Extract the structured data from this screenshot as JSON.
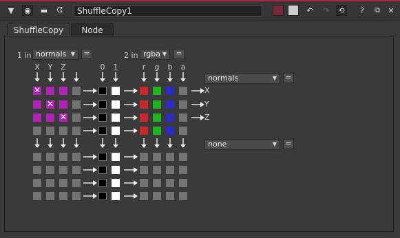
{
  "window": {
    "node_name": "ShuffleCopy1"
  },
  "tabs": [
    {
      "label": "ShuffleCopy"
    },
    {
      "label": "Node"
    }
  ],
  "input1": {
    "prefix": "1 in",
    "layer": "normals",
    "channels": [
      "X",
      "Y",
      "Z"
    ]
  },
  "input2": {
    "prefix": "2 in",
    "layer": "rgba",
    "channels": [
      "r",
      "g",
      "b",
      "a"
    ]
  },
  "const_channels": [
    "0",
    "1"
  ],
  "output1": {
    "layer": "normals",
    "channels": [
      "X",
      "Y",
      "Z"
    ]
  },
  "output2": {
    "layer": "none"
  },
  "eq_label": "=",
  "colors": {
    "accent": "#a62844",
    "magenta": "#b023b4",
    "red": "#c8282c",
    "green": "#1fb41e",
    "blue": "#2b2bc8"
  },
  "matrix": {
    "in1_rows": [
      [
        "X",
        "m",
        "m",
        "g"
      ],
      [
        "m",
        "X",
        "m",
        "g"
      ],
      [
        "m",
        "m",
        "X",
        "g"
      ],
      [
        "g",
        "g",
        "g",
        "g"
      ]
    ],
    "in2_rows": [
      [
        "rd",
        "gn",
        "bl",
        "g"
      ],
      [
        "rd",
        "gn",
        "bl",
        "g"
      ],
      [
        "rd",
        "gn",
        "bl",
        "g"
      ],
      [
        "rd",
        "gn",
        "bl",
        "g"
      ]
    ]
  }
}
